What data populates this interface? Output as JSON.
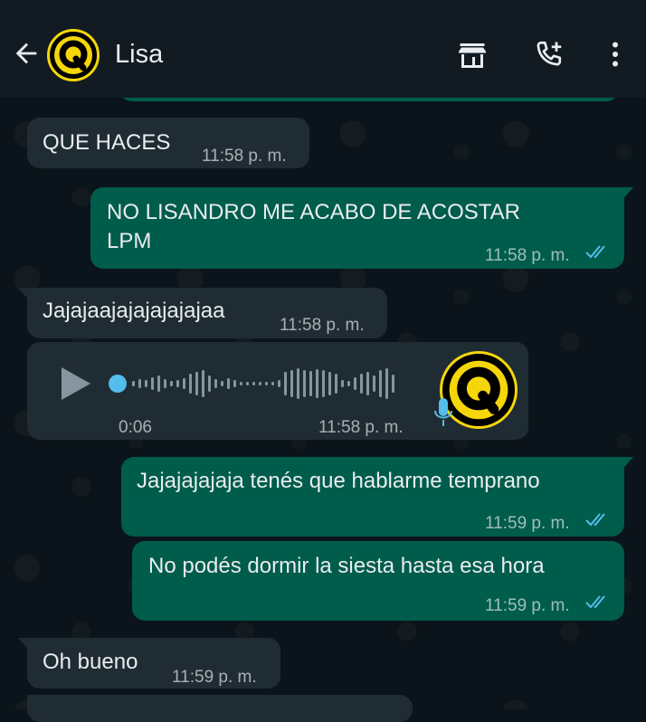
{
  "header": {
    "contact_name": "Lisa",
    "icons": [
      "back-arrow-icon",
      "avatar",
      "store-icon",
      "add-call-icon",
      "more-options-icon"
    ]
  },
  "messages": [
    {
      "direction": "in",
      "text": "QUE HACES",
      "time": "11:58 p. m."
    },
    {
      "direction": "out",
      "text_line1": "NO LISANDRO ME ACABO DE ACOSTAR",
      "text_line2": "LPM",
      "time": "11:58 p. m.",
      "status": "read"
    },
    {
      "direction": "in",
      "text": "Jajajaajajajajajajaa",
      "time": "11:58 p. m."
    },
    {
      "direction": "in",
      "type": "voice",
      "duration": "0:06",
      "time": "11:58 p. m."
    },
    {
      "direction": "out",
      "text": "Jajajajajaja tenés que hablarme temprano",
      "time": "11:59 p. m.",
      "status": "read"
    },
    {
      "direction": "out",
      "text": "No podés dormir la siesta hasta esa hora",
      "time": "11:59 p. m.",
      "status": "read"
    },
    {
      "direction": "in",
      "text": "Oh bueno",
      "time": "11:59 p. m."
    }
  ],
  "colors": {
    "incoming_bubble": "#202c33",
    "outgoing_bubble": "#005c4b",
    "read_ticks": "#53bdeb",
    "avatar_ring": "#f5d60a"
  }
}
